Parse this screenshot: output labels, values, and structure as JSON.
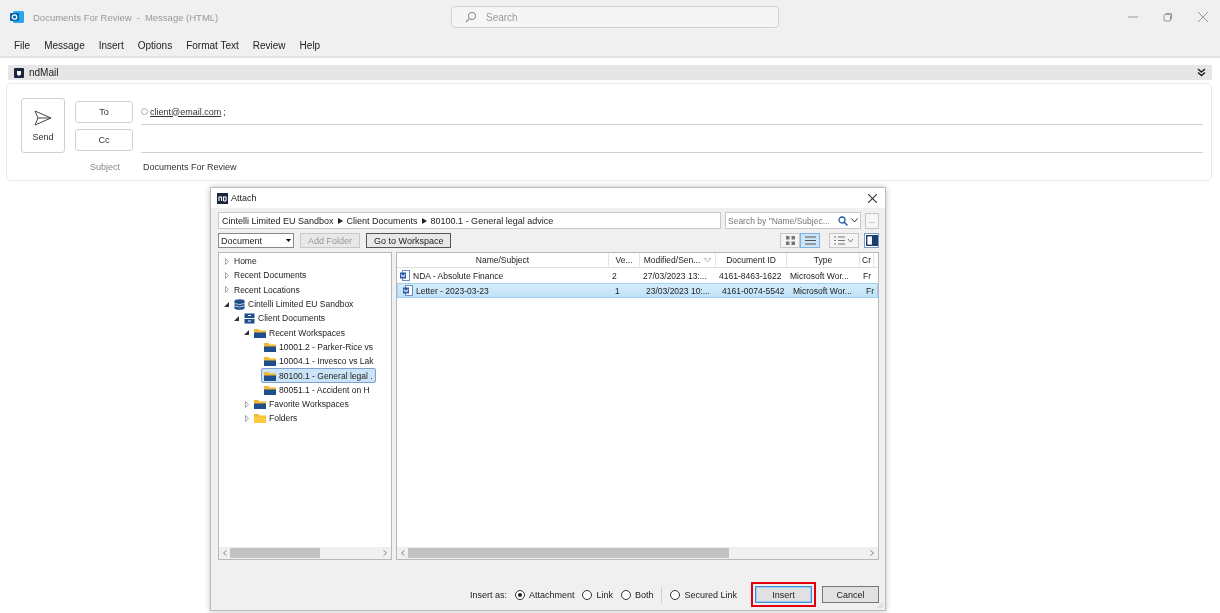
{
  "window": {
    "title": "Documents For Review",
    "title_separator": "-",
    "subtitle": "Message (HTML)",
    "search_placeholder": "Search"
  },
  "menu": [
    {
      "label": "File"
    },
    {
      "label": "Message"
    },
    {
      "label": "Insert"
    },
    {
      "label": "Options"
    },
    {
      "label": "Format Text"
    },
    {
      "label": "Review"
    },
    {
      "label": "Help"
    }
  ],
  "addin_bar": {
    "title": "ndMail"
  },
  "compose": {
    "send": "Send",
    "to_button": "To",
    "cc_button": "Cc",
    "to_value": "client@email.com",
    "to_separator": ";",
    "subject_label": "Subject",
    "subject": "Documents For Review"
  },
  "dialog": {
    "title": "Attach",
    "breadcrumb": [
      "Cintelli Limited EU Sandbox",
      "Client Documents",
      "80100.1 - General legal advice"
    ],
    "search_placeholder": "Search by \"Name/Subjec...",
    "more_button": "...",
    "type_select": "Document",
    "add_folder": {
      "label": "Add Folder",
      "disabled": true
    },
    "go_to_workspace": "Go to Workspace",
    "views": [
      {
        "kind": "grid",
        "selected": false
      },
      {
        "kind": "list",
        "selected": true
      }
    ],
    "tree": [
      {
        "label": "Home",
        "kind": "plain",
        "expanded": false,
        "selected": false
      },
      {
        "label": "Recent Documents",
        "kind": "plain",
        "expanded": false,
        "selected": false
      },
      {
        "label": "Recent Locations",
        "kind": "plain",
        "expanded": false,
        "selected": false
      },
      {
        "label": "Cintelli Limited EU Sandbox",
        "kind": "database",
        "expanded": true,
        "selected": false,
        "children": [
          {
            "label": "Client Documents",
            "kind": "cabinet",
            "expanded": true,
            "selected": false,
            "children": [
              {
                "label": "Recent Workspaces",
                "kind": "workspace",
                "expanded": true,
                "selected": false,
                "children": [
                  {
                    "label": "10001.2 - Parker-Rice vs",
                    "kind": "workspace",
                    "selected": false
                  },
                  {
                    "label": "10004.1 - Invesco vs Lak",
                    "kind": "workspace",
                    "selected": false
                  },
                  {
                    "label": "80100.1 - General legal .",
                    "kind": "workspace",
                    "selected": true
                  },
                  {
                    "label": "80051.1 - Accident on H",
                    "kind": "workspace",
                    "selected": false
                  }
                ]
              },
              {
                "label": "Favorite Workspaces",
                "kind": "workspace",
                "expanded": false,
                "selected": false
              },
              {
                "label": "Folders",
                "kind": "folder",
                "expanded": false,
                "selected": false
              }
            ]
          }
        ]
      }
    ],
    "columns": [
      {
        "label": "Name/Subject"
      },
      {
        "label": "Ve..."
      },
      {
        "label": "Modified/Sen...",
        "sorted": true
      },
      {
        "label": "Document ID"
      },
      {
        "label": "Type"
      },
      {
        "label": "Cr"
      }
    ],
    "rows": [
      {
        "cells": [
          "NDA - Absolute Finance",
          "2",
          "27/03/2023 13:...",
          "4161-8463-1622",
          "Microsoft Wor...",
          "Fr"
        ],
        "selected": false
      },
      {
        "cells": [
          "Letter - 2023-03-23",
          "1",
          "23/03/2023 10:...",
          "4161-0074-5542",
          "Microsoft Wor...",
          "Fr"
        ],
        "selected": true
      }
    ],
    "insert_as_label": "Insert as:",
    "options": [
      {
        "label": "Attachment",
        "selected": true
      },
      {
        "label": "Link",
        "selected": false
      },
      {
        "label": "Both",
        "selected": false
      },
      {
        "label": "Secured Link",
        "selected": false
      }
    ],
    "buttons": [
      {
        "label": "Insert",
        "kind": "default",
        "highlighted": true
      },
      {
        "label": "Cancel",
        "kind": "normal",
        "highlighted": false
      }
    ]
  }
}
